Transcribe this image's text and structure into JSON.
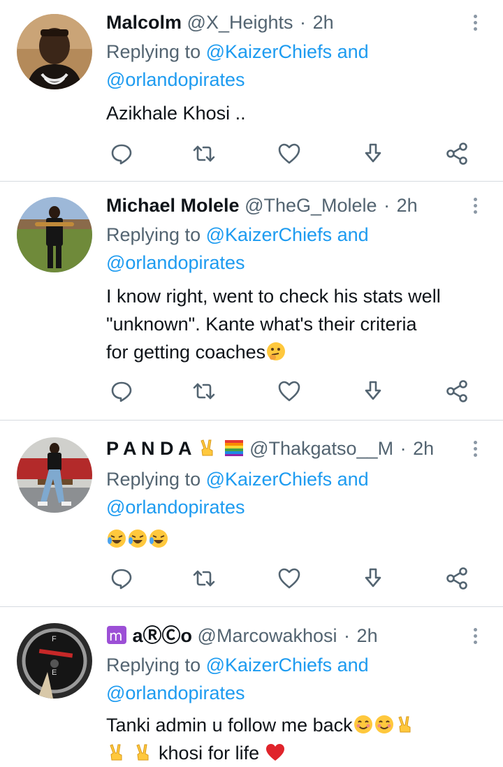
{
  "reply_prefix": "Replying to",
  "tweets": [
    {
      "name": "Malcolm",
      "handle": "@X_Heights",
      "separator": "·",
      "time": "2h",
      "reply_mention_1": "@KaizerChiefs",
      "reply_and": "and",
      "reply_mention_2": "@orlandopirates",
      "text_lines": [
        "Azikhale Khosi .."
      ]
    },
    {
      "name": "Michael Molele",
      "handle": "@TheG_Molele",
      "separator": "·",
      "time": "2h",
      "reply_mention_1": "@KaizerChiefs",
      "reply_and": "and",
      "reply_mention_2": "@orlandopirates",
      "text_lines": [
        "I know right, went to check his stats well",
        "\"unknown\". Kante what's their criteria",
        "for getting coaches"
      ]
    },
    {
      "name": "P A N D A",
      "handle": "@Thakgatso__M",
      "separator": "·",
      "time": "2h",
      "reply_mention_1": "@KaizerChiefs",
      "reply_and": "and",
      "reply_mention_2": "@orlandopirates",
      "text_lines": [
        ""
      ]
    },
    {
      "name": "aⓇⒸo",
      "name_prefix_symbol": "♍",
      "handle": "@Marcowakhosi",
      "separator": "·",
      "time": "2h",
      "reply_mention_1": "@KaizerChiefs",
      "reply_and": "and",
      "reply_mention_2": "@orlandopirates",
      "text_lines": [
        "Tanki admin u follow me back",
        "khosi for life"
      ]
    }
  ],
  "icons": {
    "reply": "comment-icon",
    "retweet": "retweet-icon",
    "like": "heart-icon",
    "download": "download-icon",
    "share": "share-icon",
    "more": "more-vertical-icon"
  },
  "colors": {
    "mention": "#1d9bf0",
    "muted": "#536471",
    "divider": "#d6dbe0"
  }
}
